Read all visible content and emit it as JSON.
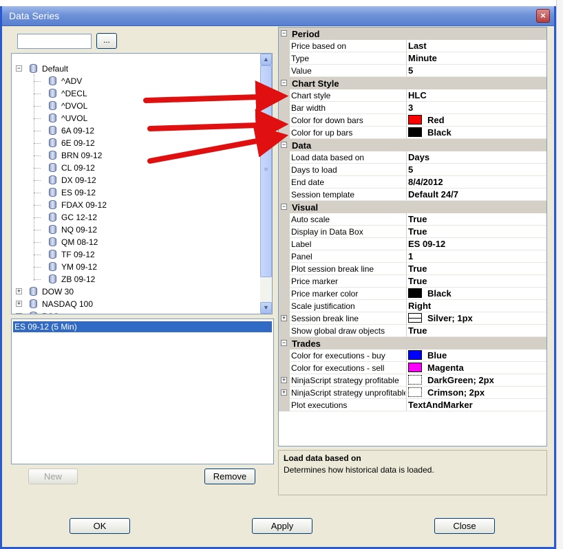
{
  "window": {
    "title": "Data Series",
    "close_glyph": "×"
  },
  "left": {
    "search": {
      "value": ""
    },
    "browse_label": "...",
    "tree": [
      {
        "label": "Default",
        "level": 0,
        "expanded": true
      },
      {
        "label": "^ADV",
        "level": 1
      },
      {
        "label": "^DECL",
        "level": 1
      },
      {
        "label": "^DVOL",
        "level": 1
      },
      {
        "label": "^UVOL",
        "level": 1
      },
      {
        "label": "6A 09-12",
        "level": 1
      },
      {
        "label": "6E 09-12",
        "level": 1
      },
      {
        "label": "BRN 09-12",
        "level": 1
      },
      {
        "label": "CL 09-12",
        "level": 1
      },
      {
        "label": "DX 09-12",
        "level": 1
      },
      {
        "label": "ES 09-12",
        "level": 1
      },
      {
        "label": "FDAX 09-12",
        "level": 1
      },
      {
        "label": "GC 12-12",
        "level": 1
      },
      {
        "label": "NQ 09-12",
        "level": 1
      },
      {
        "label": "QM 08-12",
        "level": 1
      },
      {
        "label": "TF 09-12",
        "level": 1
      },
      {
        "label": "YM 09-12",
        "level": 1
      },
      {
        "label": "ZB 09-12",
        "level": 1
      },
      {
        "label": "DOW 30",
        "level": 0,
        "expanded": false
      },
      {
        "label": "NASDAQ 100",
        "level": 0,
        "expanded": false
      },
      {
        "label": "RSS",
        "level": 0,
        "expanded": false
      }
    ],
    "series_list": [
      "ES 09-12 (5 Min)"
    ],
    "new_label": "New",
    "remove_label": "Remove"
  },
  "properties": {
    "categories": [
      {
        "name": "Period",
        "rows": [
          {
            "name": "Price based on",
            "value": "Last"
          },
          {
            "name": "Type",
            "value": "Minute"
          },
          {
            "name": "Value",
            "value": "5"
          }
        ]
      },
      {
        "name": "Chart Style",
        "rows": [
          {
            "name": "Chart style",
            "value": "HLC"
          },
          {
            "name": "Bar width",
            "value": "3"
          },
          {
            "name": "Color for down bars",
            "value": "Red",
            "color": "#ff0000"
          },
          {
            "name": "Color for up bars",
            "value": "Black",
            "color": "#000000"
          }
        ]
      },
      {
        "name": "Data",
        "rows": [
          {
            "name": "Load data based on",
            "value": "Days"
          },
          {
            "name": "Days to load",
            "value": "5"
          },
          {
            "name": "End date",
            "value": "8/4/2012"
          },
          {
            "name": "Session template",
            "value": "Default 24/7"
          }
        ]
      },
      {
        "name": "Visual",
        "rows": [
          {
            "name": "Auto scale",
            "value": "True"
          },
          {
            "name": "Display in Data Box",
            "value": "True"
          },
          {
            "name": "Label",
            "value": "ES 09-12"
          },
          {
            "name": "Panel",
            "value": "1"
          },
          {
            "name": "Plot session break line",
            "value": "True"
          },
          {
            "name": "Price marker",
            "value": "True"
          },
          {
            "name": "Price marker color",
            "value": "Black",
            "color": "#000000"
          },
          {
            "name": "Scale justification",
            "value": "Right"
          },
          {
            "name": "Session break line",
            "value": "Silver; 1px",
            "expandable": true,
            "line": "solid"
          },
          {
            "name": "Show global draw objects",
            "value": "True"
          }
        ]
      },
      {
        "name": "Trades",
        "rows": [
          {
            "name": "Color for executions - buy",
            "value": "Blue",
            "color": "#0000ff"
          },
          {
            "name": "Color for executions - sell",
            "value": "Magenta",
            "color": "#ff00ff"
          },
          {
            "name": "NinjaScript strategy profitable",
            "value": "DarkGreen; 2px",
            "expandable": true,
            "line": "dotted"
          },
          {
            "name": "NinjaScript strategy unprofitable",
            "value": "Crimson; 2px",
            "expandable": true,
            "line": "dotted"
          },
          {
            "name": "Plot executions",
            "value": "TextAndMarker"
          }
        ]
      }
    ]
  },
  "description": {
    "title": "Load data based on",
    "text": "Determines how historical data is loaded."
  },
  "footer": {
    "ok_label": "OK",
    "apply_label": "Apply",
    "close_label": "Close"
  }
}
